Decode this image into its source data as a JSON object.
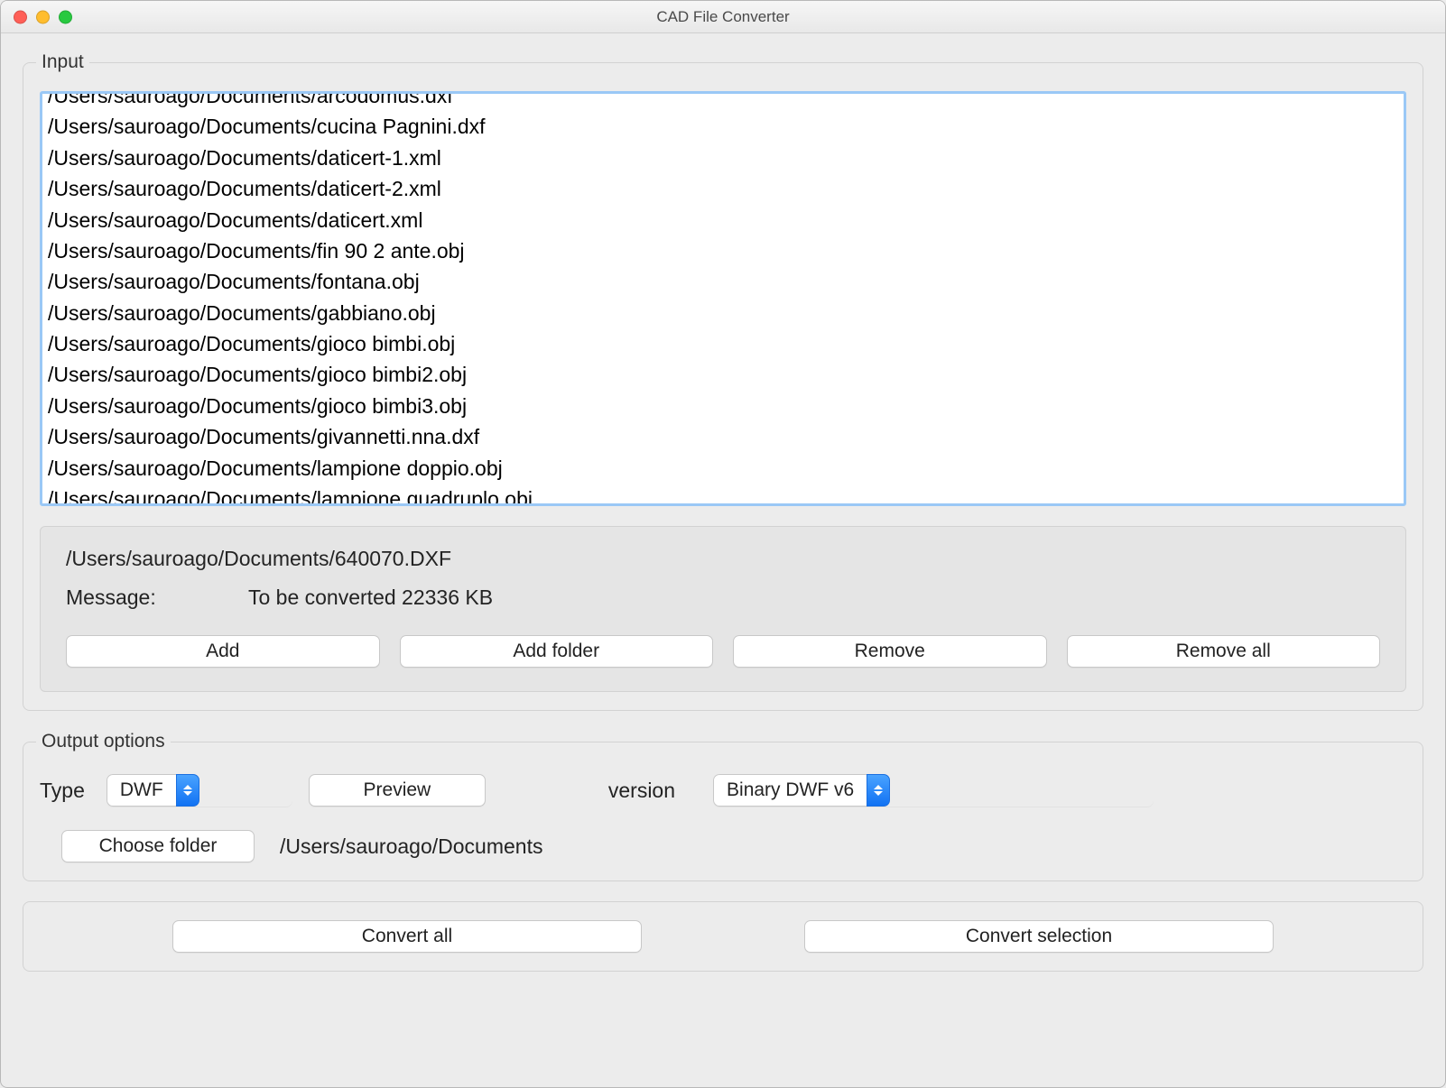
{
  "window": {
    "title": "CAD File Converter"
  },
  "input": {
    "legend": "Input",
    "files": [
      "/Users/sauroago/Documents/arcodomus.dxf",
      "/Users/sauroago/Documents/cucina Pagnini.dxf",
      "/Users/sauroago/Documents/daticert-1.xml",
      "/Users/sauroago/Documents/daticert-2.xml",
      "/Users/sauroago/Documents/daticert.xml",
      "/Users/sauroago/Documents/fin 90 2 ante.obj",
      "/Users/sauroago/Documents/fontana.obj",
      "/Users/sauroago/Documents/gabbiano.obj",
      "/Users/sauroago/Documents/gioco bimbi.obj",
      "/Users/sauroago/Documents/gioco bimbi2.obj",
      "/Users/sauroago/Documents/gioco bimbi3.obj",
      "/Users/sauroago/Documents/givannetti.nna.dxf",
      "/Users/sauroago/Documents/lampione doppio.obj",
      "/Users/sauroago/Documents/lampione quadruplo.obj"
    ],
    "detail_path": "/Users/sauroago/Documents/640070.DXF",
    "message_label": "Message:",
    "message_value": "To be converted 22336 KB",
    "buttons": {
      "add": "Add",
      "add_folder": "Add folder",
      "remove": "Remove",
      "remove_all": "Remove all"
    }
  },
  "output": {
    "legend": "Output options",
    "type_label": "Type",
    "type_value": "DWF",
    "preview_label": "Preview",
    "version_label": "version",
    "version_value": "Binary DWF v6",
    "choose_folder_label": "Choose folder",
    "folder_path": "/Users/sauroago/Documents"
  },
  "convert": {
    "convert_all": "Convert all",
    "convert_selection": "Convert selection"
  }
}
